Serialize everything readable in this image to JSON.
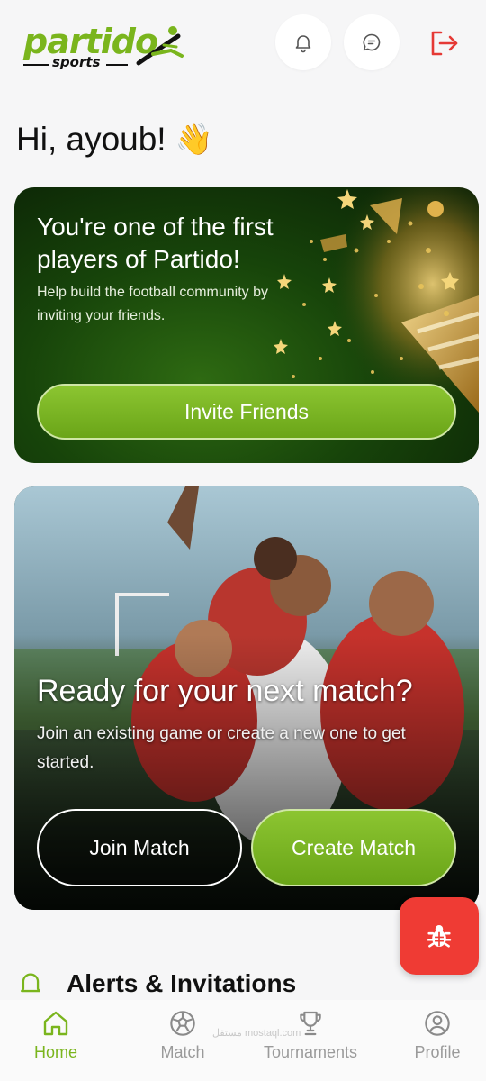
{
  "header": {
    "logo_main": "partido",
    "logo_sub": "sports",
    "icons": [
      "bell-icon",
      "chat-icon",
      "logout-icon"
    ]
  },
  "greeting": {
    "text": "Hi, ayoub!",
    "emoji": "👋"
  },
  "promo_card": {
    "title": "You're one of the first players of Partido!",
    "subtitle": "Help build the football community by inviting your friends.",
    "button_label": "Invite Friends"
  },
  "match_card": {
    "title": "Ready for your next match?",
    "subtitle": "Join an existing game or create a new one to get started.",
    "join_label": "Join Match",
    "create_label": "Create Match"
  },
  "alerts": {
    "title": "Alerts & Invitations"
  },
  "bottom_nav": {
    "items": [
      {
        "label": "Home",
        "icon": "home-icon",
        "active": true
      },
      {
        "label": "Match",
        "icon": "soccer-ball-icon",
        "active": false
      },
      {
        "label": "Tournaments",
        "icon": "trophy-icon",
        "active": false
      },
      {
        "label": "Profile",
        "icon": "user-icon",
        "active": false
      }
    ]
  },
  "watermark": "مستقل mostaql.com",
  "colors": {
    "accent": "#7ab51d",
    "danger": "#ef3b34",
    "background": "#f6f6f7"
  }
}
